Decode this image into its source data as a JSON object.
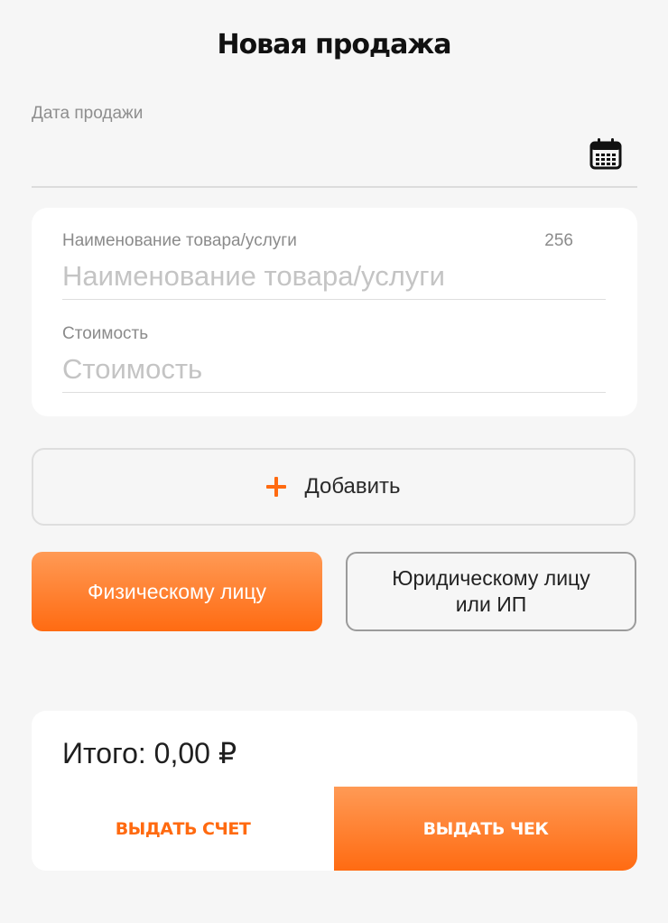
{
  "header": {
    "title": "Новая продажа"
  },
  "date_field": {
    "label": "Дата продажи",
    "value": "",
    "icon": "calendar-icon"
  },
  "item_card": {
    "name_field": {
      "label": "Наименование товара/услуги",
      "placeholder": "Наименование товара/услуги",
      "counter": "256",
      "value": ""
    },
    "price_field": {
      "label": "Стоимость",
      "placeholder": "Стоимость",
      "value": ""
    }
  },
  "add_button": {
    "label": "Добавить",
    "icon": "plus-icon"
  },
  "buyer_type": {
    "individual_label": "Физическому лицу",
    "legal_label": "Юридическому лицу\nили ИП",
    "selected": "individual"
  },
  "summary": {
    "total_text": "Итого: 0,00 ₽",
    "invoice_label": "ВЫДАТЬ СЧЕТ",
    "receipt_label": "ВЫДАТЬ ЧЕК"
  },
  "colors": {
    "accent": "#ff6b12",
    "accent_light": "#ff9a55",
    "background": "#f6f6f6",
    "card": "#ffffff"
  }
}
